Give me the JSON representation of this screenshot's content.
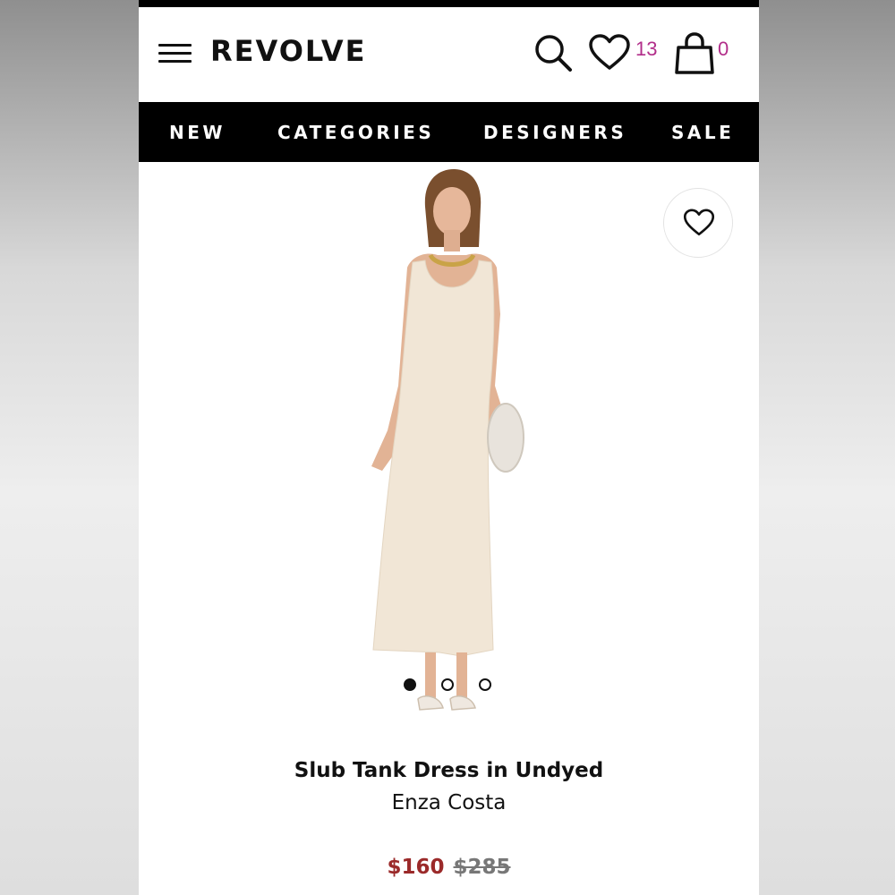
{
  "header": {
    "logo": "REVOLVE",
    "wishlist_count": "13",
    "bag_count": "0",
    "icons": [
      "menu-icon",
      "search-icon",
      "heart-icon",
      "bag-icon"
    ],
    "count_color": "#b22e8a"
  },
  "nav": {
    "items": [
      {
        "label": "NEW"
      },
      {
        "label": "CATEGORIES"
      },
      {
        "label": "DESIGNERS"
      },
      {
        "label": "SALE"
      }
    ]
  },
  "product": {
    "title": "Slub Tank Dress in Undyed",
    "brand": "Enza Costa",
    "sale_price": "$160",
    "original_price": "$285",
    "sale_color": "#9b2a2a",
    "image_count": 3,
    "active_image": 1
  }
}
